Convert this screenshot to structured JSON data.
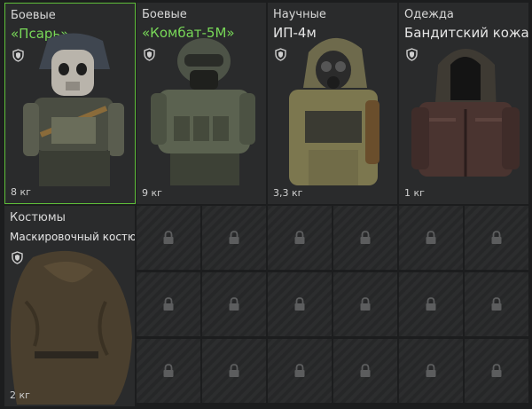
{
  "items": [
    {
      "category": "Боевые",
      "name": "«Псарь»",
      "weight": "8 кг",
      "icon": "psar-armor-icon"
    },
    {
      "category": "Боевые",
      "name": "«Комбат-5М»",
      "weight": "9 кг",
      "icon": "kombat-armor-icon"
    },
    {
      "category": "Научные",
      "name": "ИП-4м",
      "weight": "3,3 кг",
      "icon": "gasmask-suit-icon"
    },
    {
      "category": "Одежда",
      "name": "Бандитский кожак",
      "weight": "1 кг",
      "icon": "leather-jacket-icon"
    },
    {
      "category": "Костюмы",
      "name": "Маскировочный костюм...",
      "weight": "2 кг",
      "icon": "ghillie-suit-icon"
    }
  ],
  "locked_slot_icon": "padlock-icon",
  "colors": {
    "selected_border": "#5fbf3a",
    "highlight_name": "#78d858",
    "card_bg": "#2a2b2c"
  }
}
